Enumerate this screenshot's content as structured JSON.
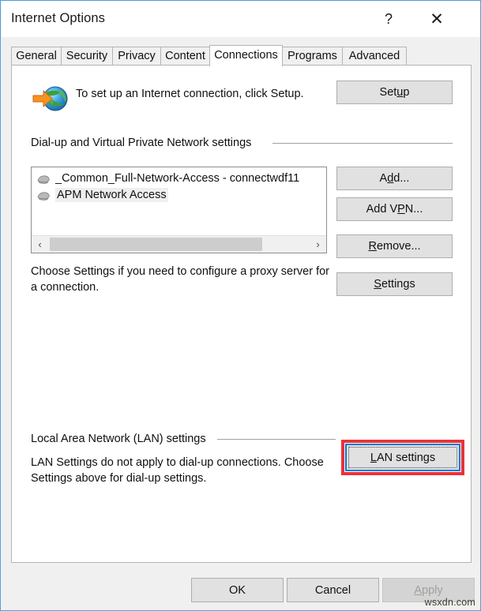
{
  "window": {
    "title": "Internet Options",
    "border_color": "#4aa3df",
    "caption_buttons": [
      {
        "name": "help",
        "glyph": "?"
      },
      {
        "name": "close",
        "glyph": "✕"
      }
    ]
  },
  "tabs": [
    {
      "label": "General",
      "selected": false
    },
    {
      "label": "Security",
      "selected": false
    },
    {
      "label": "Privacy",
      "selected": false
    },
    {
      "label": "Content",
      "selected": false
    },
    {
      "label": "Connections",
      "selected": true
    },
    {
      "label": "Programs",
      "selected": false
    },
    {
      "label": "Advanced",
      "selected": false
    }
  ],
  "setup": {
    "description": "To set up an Internet connection, click Setup.",
    "button_label_pre": "Set",
    "button_label_acc": "u",
    "button_label_post": "p",
    "icon": "globe-arrow-icon"
  },
  "dialup_group": {
    "label": "Dial-up and Virtual Private Network settings",
    "items": [
      {
        "name": "_Common_Full-Network-Access - connectwdf11",
        "highlighted": false
      },
      {
        "name": "APM Network Access",
        "highlighted": true
      }
    ],
    "scrollbar": {
      "left_glyph": "‹",
      "right_glyph": "›"
    },
    "hint": "Choose Settings if you need to configure a proxy server for a connection.",
    "buttons": [
      {
        "pre": "A",
        "acc": "d",
        "post": "d..."
      },
      {
        "pre": "Add V",
        "acc": "P",
        "post": "N..."
      },
      {
        "pre": "",
        "acc": "R",
        "post": "emove..."
      },
      {
        "pre": "",
        "acc": "S",
        "post": "ettings"
      }
    ]
  },
  "lan_group": {
    "label": "Local Area Network (LAN) settings",
    "description": "LAN Settings do not apply to dial-up connections. Choose Settings above for dial-up settings.",
    "button_pre": "",
    "button_acc": "L",
    "button_post": "AN settings",
    "highlight_color": "#ed3237",
    "focus_color": "#0078d7"
  },
  "footer": {
    "ok": "OK",
    "cancel": "Cancel",
    "apply_pre": "",
    "apply_acc": "A",
    "apply_post": "pply",
    "apply_disabled": true
  },
  "watermark": "wsxdn.com"
}
